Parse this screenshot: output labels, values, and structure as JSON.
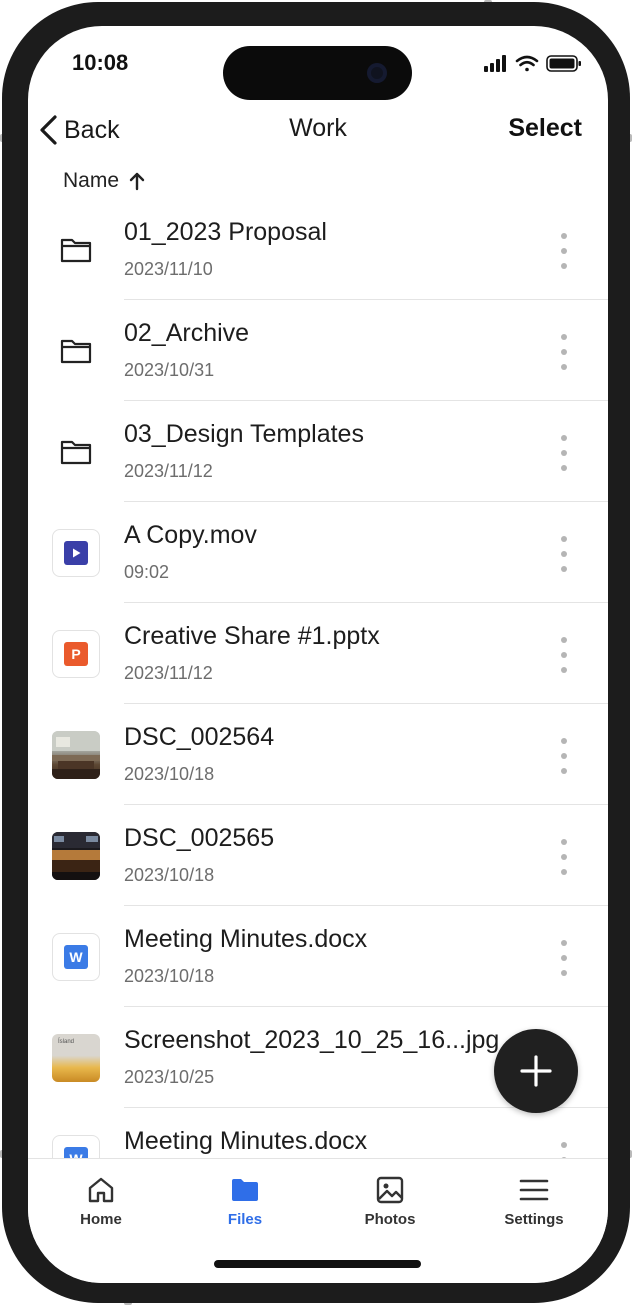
{
  "status_bar": {
    "time": "10:08"
  },
  "nav": {
    "back_label": "Back",
    "title": "Work",
    "select_label": "Select"
  },
  "sort": {
    "label": "Name",
    "direction_icon": "arrow-up-icon"
  },
  "files": [
    {
      "name": "01_2023 Proposal",
      "meta": "2023/11/10",
      "icon": "folder-icon"
    },
    {
      "name": "02_Archive",
      "meta": "2023/10/31",
      "icon": "folder-icon"
    },
    {
      "name": "03_Design Templates",
      "meta": "2023/11/12",
      "icon": "folder-icon"
    },
    {
      "name": "A Copy.mov",
      "meta": "09:02",
      "icon": "video-file-icon",
      "color": "#3a3fa8"
    },
    {
      "name": "Creative Share #1.pptx",
      "meta": "2023/11/12",
      "icon": "pptx-file-icon",
      "badge": "P",
      "color": "#ea5a2c"
    },
    {
      "name": "DSC_002564",
      "meta": "2023/10/18",
      "icon": "image-thumbnail"
    },
    {
      "name": "DSC_002565",
      "meta": "2023/10/18",
      "icon": "image-thumbnail"
    },
    {
      "name": "Meeting Minutes.docx",
      "meta": "2023/10/18",
      "icon": "docx-file-icon",
      "badge": "W",
      "color": "#3b7be6"
    },
    {
      "name": "Screenshot_2023_10_25_16...jpg",
      "meta": "2023/10/25",
      "icon": "image-thumbnail",
      "thumb_text": "Ísland"
    },
    {
      "name": "Meeting Minutes.docx",
      "meta": "",
      "icon": "docx-file-icon",
      "badge": "W",
      "color": "#3b7be6"
    }
  ],
  "fab": {
    "icon": "plus-icon"
  },
  "tabs": [
    {
      "label": "Home",
      "icon": "home-icon",
      "active": false
    },
    {
      "label": "Files",
      "icon": "folder-icon",
      "active": true
    },
    {
      "label": "Photos",
      "icon": "image-icon",
      "active": false
    },
    {
      "label": "Settings",
      "icon": "menu-icon",
      "active": false
    }
  ],
  "colors": {
    "accent": "#2f6ee8",
    "frame": "#1c1c1c",
    "text": "#1d1d1d",
    "secondary_text": "#6d6d6d"
  }
}
